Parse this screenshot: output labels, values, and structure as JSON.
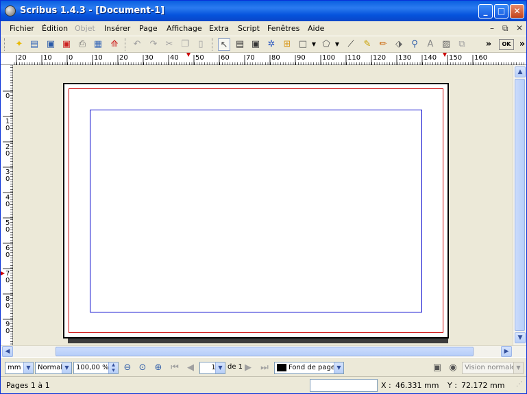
{
  "window": {
    "title": "Scribus 1.4.3 - [Document-1]",
    "minimize_label": "_",
    "maximize_label": "□",
    "close_label": "✕"
  },
  "menubar": {
    "items": [
      {
        "label": "Fichier",
        "enabled": true
      },
      {
        "label": "Édition",
        "enabled": true
      },
      {
        "label": "Objet",
        "enabled": false
      },
      {
        "label": "Insérer",
        "enabled": true
      },
      {
        "label": "Page",
        "enabled": true
      },
      {
        "label": "Affichage",
        "enabled": true
      },
      {
        "label": "Extra",
        "enabled": true
      },
      {
        "label": "Script",
        "enabled": true
      },
      {
        "label": "Fenêtres",
        "enabled": true
      },
      {
        "label": "Aide",
        "enabled": true
      }
    ],
    "mdi_minimize": "–",
    "mdi_restore": "⧉",
    "mdi_close": "✕"
  },
  "toolbar": {
    "icons": [
      "new-document-icon",
      "open-document-icon",
      "save-icon",
      "close-document-icon",
      "print-icon",
      "preflight-icon",
      "export-pdf-icon",
      "undo-icon",
      "redo-icon",
      "cut-icon",
      "copy-icon",
      "paste-icon",
      "select-item-icon",
      "text-frame-icon",
      "image-frame-icon",
      "render-frame-icon",
      "table-icon",
      "shape-icon",
      "polygon-icon",
      "line-icon",
      "bezier-curve-icon",
      "freehand-line-icon",
      "rotate-icon",
      "zoom-icon",
      "edit-text-icon",
      "eye-dropper-icon",
      "link-text-frames-icon"
    ],
    "overflow_label": "»",
    "ok_label": "OK",
    "overflow_label_2": "»"
  },
  "ruler_h": {
    "labels": [
      "20",
      "10",
      "0",
      "10",
      "20",
      "30",
      "40",
      "50",
      "60",
      "70",
      "80",
      "90",
      "100",
      "110",
      "120",
      "130",
      "140",
      "150",
      "160"
    ]
  },
  "ruler_v": {
    "labels": [
      "0",
      "1 0",
      "2 0",
      "3 0",
      "4 0",
      "5 0",
      "6 0",
      "7 0",
      "8 0",
      "9 0"
    ]
  },
  "zoombar": {
    "unit": "mm",
    "render_quality": "Normal",
    "zoom": "100,00 %",
    "current_page": "1",
    "page_of": "de 1",
    "layer": "Fond de page",
    "layer_color": "#000000",
    "view_mode": "Vision normale"
  },
  "statusbar": {
    "pages_text": "Pages 1 à 1",
    "x_label": "X :",
    "x_value": "46.331 mm",
    "y_label": "Y :",
    "y_value": "72.172 mm"
  },
  "colors": {
    "margin_guide": "#cc0000",
    "bleed_or_column_guide": "#0000cc",
    "page": "#ffffff",
    "workspace": "#ece9d8"
  }
}
